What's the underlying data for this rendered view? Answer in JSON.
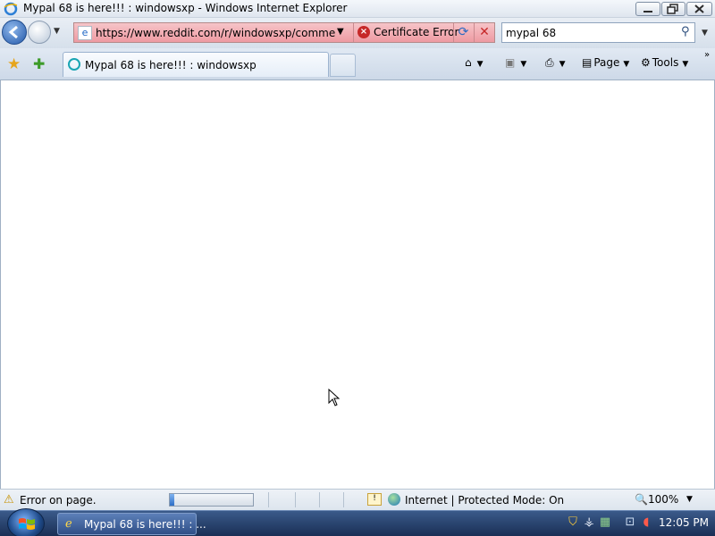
{
  "window": {
    "title": "Mypal 68 is here!!! : windowsxp - Windows Internet Explorer"
  },
  "address": {
    "url": "https://www.reddit.com/r/windowsxp/comments/",
    "cert_error": "Certificate Error"
  },
  "search": {
    "value": "mypal 68"
  },
  "tab": {
    "label": "Mypal 68 is here!!! : windowsxp"
  },
  "commands": {
    "page": "Page",
    "tools": "Tools"
  },
  "status": {
    "text": "Error on page.",
    "progress": 0.05,
    "zone": "Internet | Protected Mode: On",
    "zoom": "100%"
  },
  "taskbar": {
    "task_label": "Mypal 68 is here!!! : ...",
    "clock": "12:05 PM"
  },
  "icons": {
    "title": "internet-explorer-icon",
    "cert": "certificate-error-icon",
    "refresh": "refresh-icon",
    "stop": "stop-icon",
    "search": "search-icon",
    "favorites": "favorites-star-icon",
    "add_favorites": "add-favorites-icon",
    "home": "home-icon",
    "feeds": "feeds-icon",
    "print": "print-icon",
    "warning": "warning-icon"
  },
  "colors": {
    "address_error_bg": "#ee9aa2",
    "taskbar": "#1a2f55"
  }
}
